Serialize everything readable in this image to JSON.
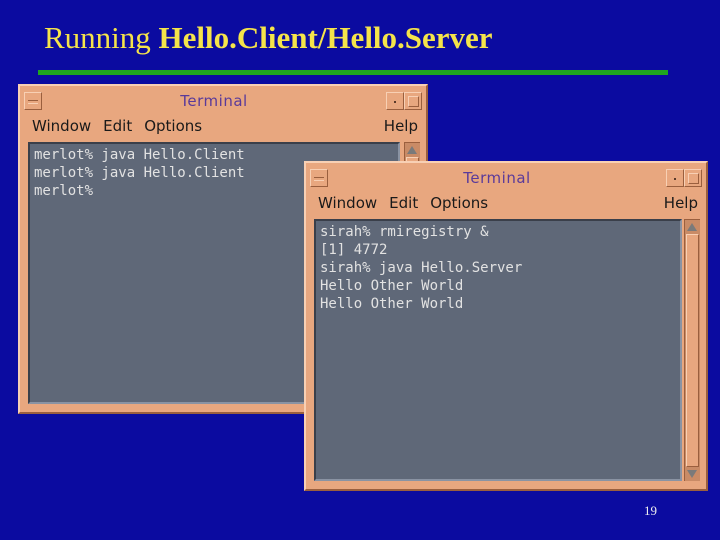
{
  "slide": {
    "title_plain": "Running ",
    "title_bold": "Hello.Client/Hello.Server",
    "page_number": "19"
  },
  "colors": {
    "background": "#0b0ba0",
    "title": "#f5e44a",
    "rule": "#1fa51f",
    "window_frame": "#e8a77f",
    "terminal_bg": "#5f6878",
    "terminal_text": "#e2e2e2"
  },
  "client_window": {
    "title": "Terminal",
    "menu": {
      "window": "Window",
      "edit": "Edit",
      "options": "Options",
      "help": "Help"
    },
    "lines": [
      "merlot% java Hello.Client",
      "merlot% java Hello.Client",
      "merlot%"
    ]
  },
  "server_window": {
    "title": "Terminal",
    "menu": {
      "window": "Window",
      "edit": "Edit",
      "options": "Options",
      "help": "Help"
    },
    "lines": [
      "sirah% rmiregistry &",
      "[1] 4772",
      "sirah% java Hello.Server",
      "Hello Other World",
      "Hello Other World"
    ]
  },
  "icons": {
    "window_menu": "window-menu-icon",
    "minimize": "minimize-icon",
    "maximize": "maximize-icon",
    "scroll_up": "scroll-up-arrow-icon",
    "scroll_down": "scroll-down-arrow-icon"
  }
}
